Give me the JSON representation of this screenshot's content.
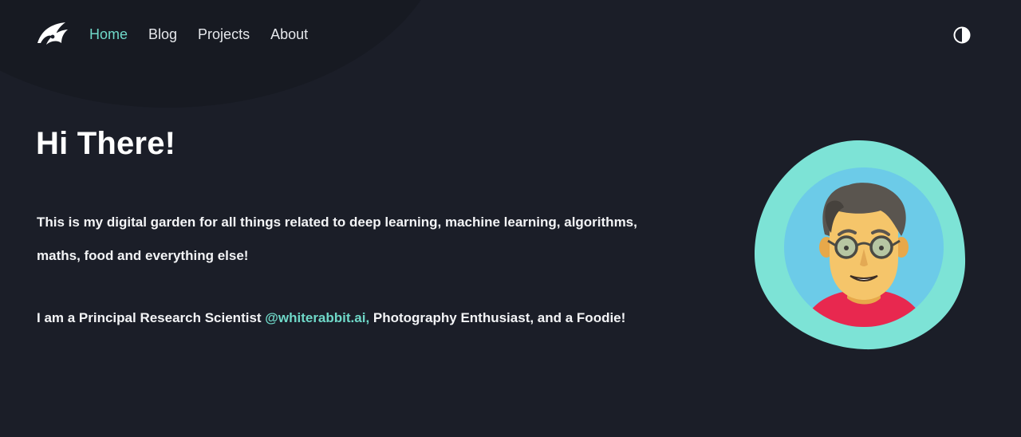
{
  "header": {
    "logo_icon": "rabbit-logo-icon",
    "nav": [
      {
        "label": "Home",
        "active": true
      },
      {
        "label": "Blog",
        "active": false
      },
      {
        "label": "Projects",
        "active": false
      },
      {
        "label": "About",
        "active": false
      }
    ],
    "theme_toggle_icon": "half-circle-contrast-icon"
  },
  "hero": {
    "title": "Hi There!",
    "intro": "This is my digital garden for all things related to deep learning, machine learning, algorithms, maths, food and everything else!",
    "role_prefix": "I am a Principal Research Scientist ",
    "role_link": "@whiterabbit.ai,",
    "role_suffix": " Photography Enthusiast, and a Foodie!"
  },
  "avatar": {
    "icon": "man-with-glasses-avatar"
  },
  "colors": {
    "background": "#1b1e28",
    "accent": "#6fd8c8",
    "text": "#f3f4f6",
    "avatar_ring": "#7de3d6",
    "avatar_circle": "#6ccbe8",
    "shirt": "#e8284f"
  }
}
